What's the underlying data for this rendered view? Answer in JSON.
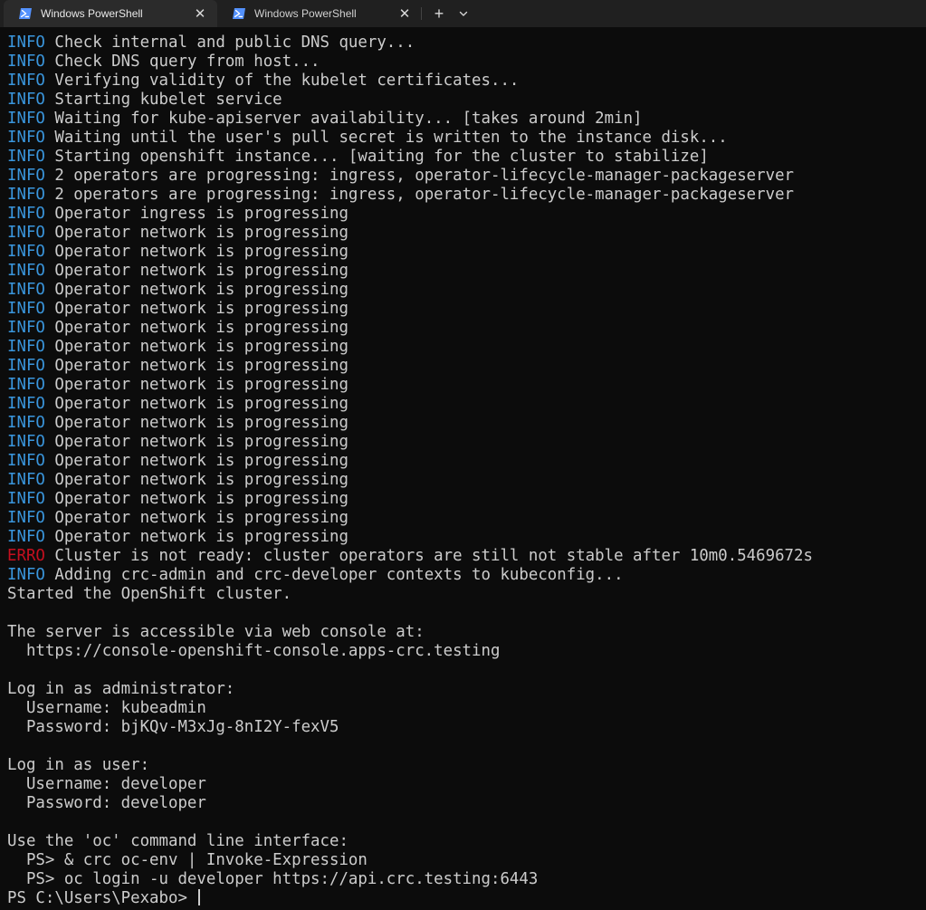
{
  "tabs": [
    {
      "title": "Windows PowerShell",
      "active": true
    },
    {
      "title": "Windows PowerShell",
      "active": false
    }
  ],
  "icons": {
    "tab": "powershell-icon",
    "close": "close-icon",
    "new_tab": "plus-icon",
    "dropdown": "chevron-down-icon"
  },
  "colors": {
    "info": "#3a96dd",
    "erro": "#c50f1f",
    "text": "#cccccc",
    "background": "#0c0c0c",
    "tabbar": "#202020"
  },
  "terminal": {
    "lines": [
      {
        "level": "INFO",
        "text": " Check internal and public DNS query..."
      },
      {
        "level": "INFO",
        "text": " Check DNS query from host..."
      },
      {
        "level": "INFO",
        "text": " Verifying validity of the kubelet certificates..."
      },
      {
        "level": "INFO",
        "text": " Starting kubelet service"
      },
      {
        "level": "INFO",
        "text": " Waiting for kube-apiserver availability... [takes around 2min]"
      },
      {
        "level": "INFO",
        "text": " Waiting until the user's pull secret is written to the instance disk..."
      },
      {
        "level": "INFO",
        "text": " Starting openshift instance... [waiting for the cluster to stabilize]"
      },
      {
        "level": "INFO",
        "text": " 2 operators are progressing: ingress, operator-lifecycle-manager-packageserver"
      },
      {
        "level": "INFO",
        "text": " 2 operators are progressing: ingress, operator-lifecycle-manager-packageserver"
      },
      {
        "level": "INFO",
        "text": " Operator ingress is progressing"
      },
      {
        "level": "INFO",
        "text": " Operator network is progressing"
      },
      {
        "level": "INFO",
        "text": " Operator network is progressing"
      },
      {
        "level": "INFO",
        "text": " Operator network is progressing"
      },
      {
        "level": "INFO",
        "text": " Operator network is progressing"
      },
      {
        "level": "INFO",
        "text": " Operator network is progressing"
      },
      {
        "level": "INFO",
        "text": " Operator network is progressing"
      },
      {
        "level": "INFO",
        "text": " Operator network is progressing"
      },
      {
        "level": "INFO",
        "text": " Operator network is progressing"
      },
      {
        "level": "INFO",
        "text": " Operator network is progressing"
      },
      {
        "level": "INFO",
        "text": " Operator network is progressing"
      },
      {
        "level": "INFO",
        "text": " Operator network is progressing"
      },
      {
        "level": "INFO",
        "text": " Operator network is progressing"
      },
      {
        "level": "INFO",
        "text": " Operator network is progressing"
      },
      {
        "level": "INFO",
        "text": " Operator network is progressing"
      },
      {
        "level": "INFO",
        "text": " Operator network is progressing"
      },
      {
        "level": "INFO",
        "text": " Operator network is progressing"
      },
      {
        "level": "INFO",
        "text": " Operator network is progressing"
      },
      {
        "level": "ERRO",
        "text": " Cluster is not ready: cluster operators are still not stable after 10m0.5469672s"
      },
      {
        "level": "INFO",
        "text": " Adding crc-admin and crc-developer contexts to kubeconfig..."
      },
      {
        "level": "",
        "text": "Started the OpenShift cluster."
      },
      {
        "level": "",
        "text": ""
      },
      {
        "level": "",
        "text": "The server is accessible via web console at:"
      },
      {
        "level": "",
        "text": "  https://console-openshift-console.apps-crc.testing"
      },
      {
        "level": "",
        "text": ""
      },
      {
        "level": "",
        "text": "Log in as administrator:"
      },
      {
        "level": "",
        "text": "  Username: kubeadmin"
      },
      {
        "level": "",
        "text": "  Password: bjKQv-M3xJg-8nI2Y-fexV5"
      },
      {
        "level": "",
        "text": ""
      },
      {
        "level": "",
        "text": "Log in as user:"
      },
      {
        "level": "",
        "text": "  Username: developer"
      },
      {
        "level": "",
        "text": "  Password: developer"
      },
      {
        "level": "",
        "text": ""
      },
      {
        "level": "",
        "text": "Use the 'oc' command line interface:"
      },
      {
        "level": "",
        "text": "  PS> & crc oc-env | Invoke-Expression"
      },
      {
        "level": "",
        "text": "  PS> oc login -u developer https://api.crc.testing:6443"
      }
    ],
    "prompt": "PS C:\\Users\\Pexabo> "
  }
}
